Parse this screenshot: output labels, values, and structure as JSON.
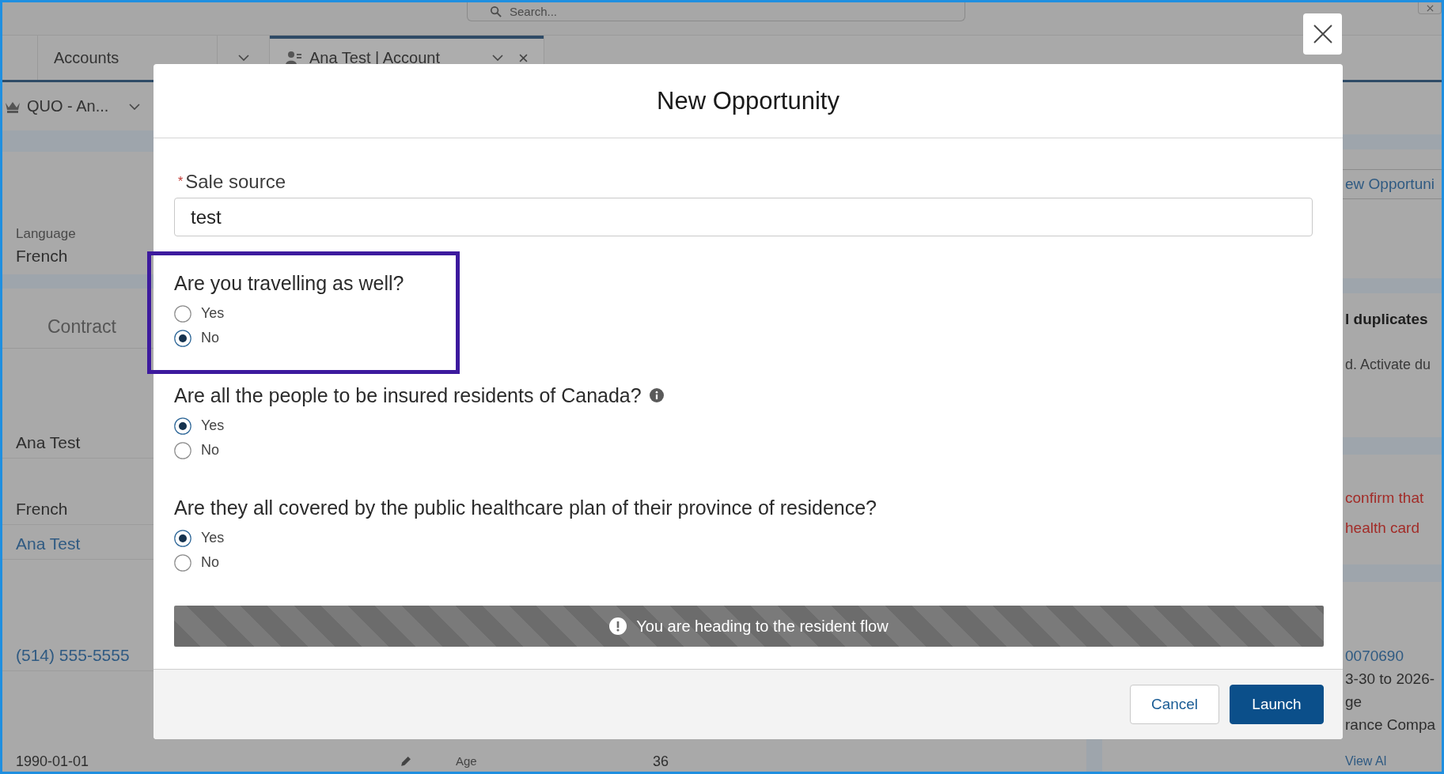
{
  "background_page": {
    "search": {
      "placeholder": "Search..."
    },
    "nav_tabs": [
      {
        "label": "Accounts",
        "kind": "nav",
        "selected": false
      },
      {
        "label": "Ana Test | Account",
        "kind": "record",
        "selected": true
      }
    ],
    "record_switcher": {
      "label": "QUO - An..."
    },
    "language_field": {
      "label": "Language",
      "value": "French"
    },
    "contract_tab": {
      "label": "Contract"
    },
    "detail_values": [
      {
        "text": "Ana Test",
        "kind": "value"
      },
      {
        "text": "French",
        "kind": "value"
      },
      {
        "text": "Ana Test",
        "kind": "link"
      },
      {
        "text": "(514) 555-5555",
        "kind": "link"
      }
    ],
    "bottom_row": {
      "value": "1990-01-01",
      "label": "Age",
      "age_value": "36"
    },
    "right_panel": {
      "button": {
        "label": "ew Opportuni"
      },
      "duplicates": {
        "title": "l duplicates",
        "text": "d. Activate du"
      },
      "alert_lines": [
        "confirm that",
        "health card"
      ],
      "details": [
        {
          "text": "0070690",
          "kind": "link"
        },
        {
          "text": "3-30 to 2026-",
          "kind": "text"
        },
        {
          "text": "ge",
          "kind": "text"
        },
        {
          "text": "rance Compa",
          "kind": "text"
        }
      ],
      "view_all": {
        "label": "View Al"
      }
    }
  },
  "modal": {
    "title": "New Opportunity",
    "field": {
      "label": "Sale source",
      "required_mark": "*",
      "value": "test"
    },
    "questions": [
      {
        "text": "Are you travelling as well?",
        "info_icon": false,
        "highlighted": true,
        "options": [
          {
            "label": "Yes",
            "selected": false
          },
          {
            "label": "No",
            "selected": true
          }
        ]
      },
      {
        "text": "Are all the people to be insured residents of Canada?",
        "info_icon": true,
        "highlighted": false,
        "options": [
          {
            "label": "Yes",
            "selected": true
          },
          {
            "label": "No",
            "selected": false
          }
        ]
      },
      {
        "text": "Are they all covered by the public healthcare plan of their province of residence?",
        "info_icon": false,
        "highlighted": false,
        "options": [
          {
            "label": "Yes",
            "selected": true
          },
          {
            "label": "No",
            "selected": false
          }
        ]
      }
    ],
    "banner": {
      "text": "You are heading to the resident flow"
    },
    "buttons": [
      {
        "label": "Cancel",
        "kind": "neutral"
      },
      {
        "label": "Launch",
        "kind": "brand"
      }
    ]
  }
}
